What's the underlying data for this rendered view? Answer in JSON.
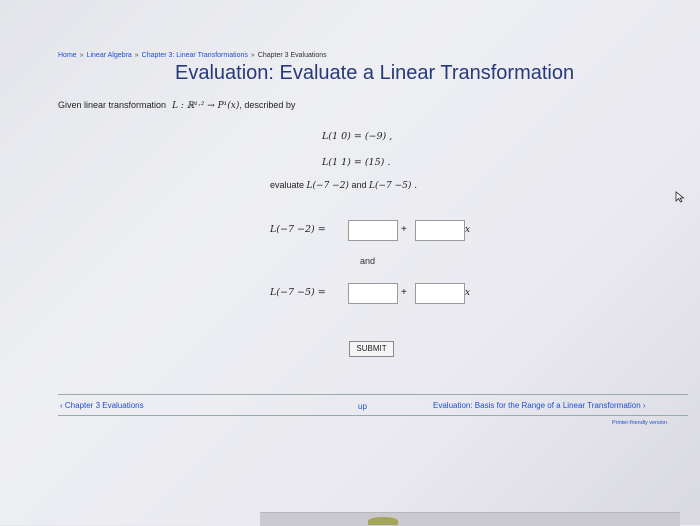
{
  "breadcrumb": {
    "items": [
      "Home",
      "Linear Algebra",
      "Chapter 3: Linear Transformations",
      "Chapter 3 Evaluations"
    ],
    "separator": "»"
  },
  "title": "Evaluation: Evaluate a Linear Transformation",
  "given": {
    "text": "Given linear transformation",
    "map": "L : ℝ^{1,2} → P¹(x)",
    "map_display": "L : ℝ¹·² → P¹(x)",
    "suffix": ", described by"
  },
  "conditions": [
    "L(1  0) = (−9) ,",
    "L(1  1) = (15) ."
  ],
  "evaluate": {
    "label": "evaluate",
    "first": "L(−7  −2)",
    "and": "and",
    "second": "L(−7  −5) ."
  },
  "answers": [
    {
      "lhs": "L(−7  −2) =",
      "plus": "+",
      "var": "x",
      "constant_value": "",
      "coefficient_value": ""
    },
    {
      "lhs": "L(−7  −5) =",
      "plus": "+",
      "var": "x",
      "constant_value": "",
      "coefficient_value": ""
    }
  ],
  "and_text": "and",
  "submit_label": "SUBMIT",
  "nav": {
    "prev": "‹ Chapter 3 Evaluations",
    "up": "up",
    "next": "Evaluation: Basis for the Range of a Linear Transformation ›",
    "printer": "Printer-friendly version"
  },
  "colors": {
    "link": "#1f4fd1",
    "title": "#263a7a"
  }
}
